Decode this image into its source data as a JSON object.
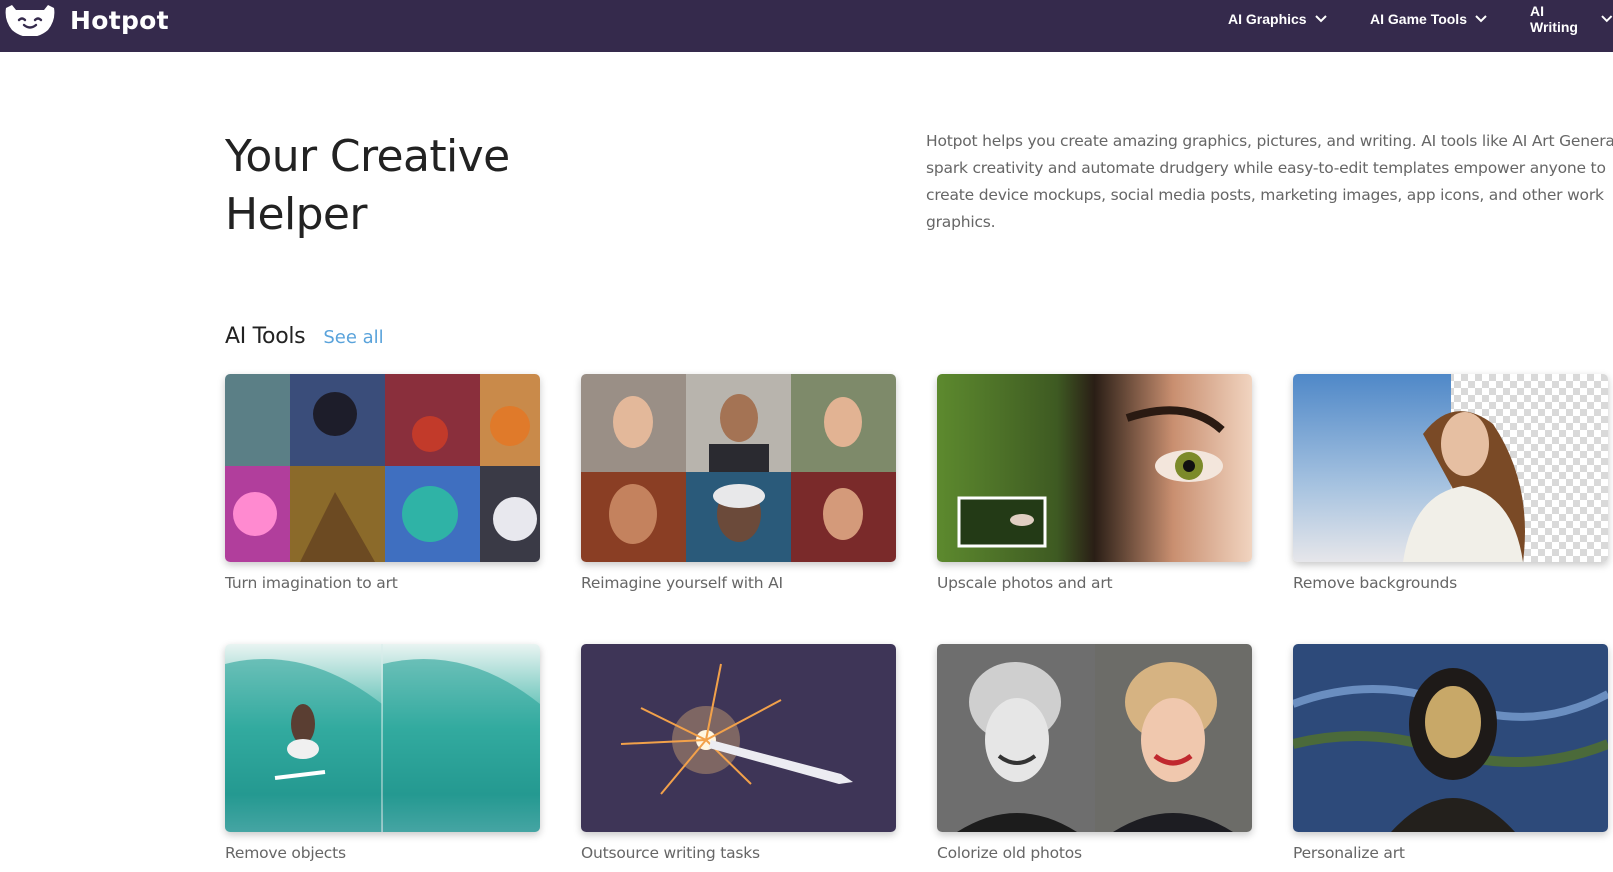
{
  "brand": {
    "name": "Hotpot"
  },
  "nav": {
    "items": [
      {
        "label": "AI Graphics",
        "icon": "chevron-down-icon"
      },
      {
        "label": "AI Game Tools",
        "icon": "chevron-down-icon"
      },
      {
        "label": "AI Writing",
        "icon": "chevron-down-icon"
      }
    ]
  },
  "hero": {
    "title": "Your Creative Helper",
    "description": "Hotpot helps you create amazing graphics, pictures, and writing. AI tools like AI Art Generator spark creativity and automate drudgery while easy-to-edit templates empower anyone to create device mockups, social media posts, marketing images, app icons, and other work graphics."
  },
  "tools": {
    "heading": "AI Tools",
    "see_all": "See all",
    "cards": [
      {
        "caption": "Turn imagination to art"
      },
      {
        "caption": "Reimagine yourself with AI"
      },
      {
        "caption": "Upscale photos and art"
      },
      {
        "caption": "Remove backgrounds"
      },
      {
        "caption": "Remove objects"
      },
      {
        "caption": "Outsource writing tasks"
      },
      {
        "caption": "Colorize old photos"
      },
      {
        "caption": "Personalize art"
      }
    ]
  },
  "colors": {
    "nav_bg": "#352a4c",
    "link": "#5aa3db",
    "caption": "#666666"
  }
}
